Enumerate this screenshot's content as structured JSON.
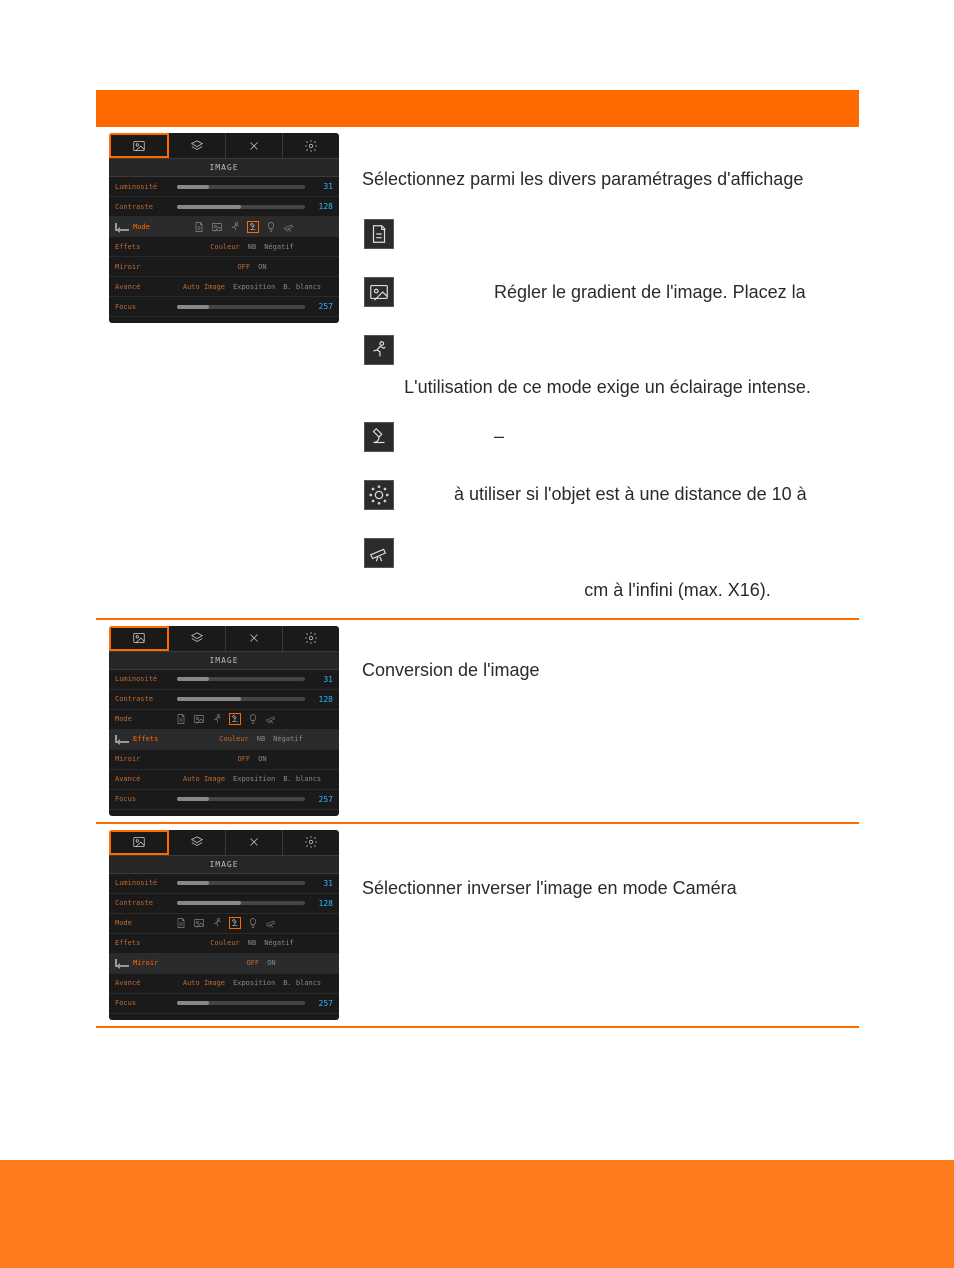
{
  "colors": {
    "accent": "#ff6a00",
    "dark": "#1a1a1a",
    "cyan": "#2fb5ff"
  },
  "osd": {
    "title": "IMAGE",
    "rows": {
      "luminosite": {
        "label": "Luminosité",
        "value": "31",
        "fill_pct": 25
      },
      "contraste": {
        "label": "Contraste",
        "value": "128",
        "fill_pct": 50
      },
      "mode": {
        "label": "Mode"
      },
      "effets": {
        "label": "Effets",
        "options": [
          "Couleur",
          "NB",
          "Négatif"
        ],
        "active": 0
      },
      "miroir": {
        "label": "Miroir",
        "options": [
          "OFF",
          "ON"
        ],
        "active": 0
      },
      "avance": {
        "label": "Avancé",
        "options": [
          "Auto Image",
          "Exposition",
          "B. blancs"
        ],
        "active": 0
      },
      "focus": {
        "label": "Focus",
        "value": "257"
      }
    },
    "mode_icons": [
      "doc-icon",
      "photo-icon",
      "runner-icon",
      "microscope-icon",
      "bulb-icon",
      "telescope-icon"
    ]
  },
  "sections": {
    "mode": {
      "lead": "Sélectionnez parmi les divers paramétrages d'affichage",
      "items": [
        {
          "icon": "doc-icon",
          "text": ""
        },
        {
          "icon": "photo-icon",
          "text": "Régler le gradient de l'image. Placez la"
        },
        {
          "icon": "runner-icon",
          "text": "L'utilisation de ce mode exige un éclairage intense."
        },
        {
          "icon": "microscope-icon",
          "text": "–"
        },
        {
          "icon": "gear-dots-icon",
          "text": "à utiliser si l'objet est à une distance de 10 à"
        },
        {
          "icon": "telescope-icon",
          "text": "cm à l'infini (max. X16)."
        }
      ]
    },
    "effets": {
      "highlight": "effets",
      "lead": "Conversion de l'image"
    },
    "miroir": {
      "highlight": "miroir",
      "lead": "Sélectionner inverser l'image en mode Caméra"
    }
  }
}
